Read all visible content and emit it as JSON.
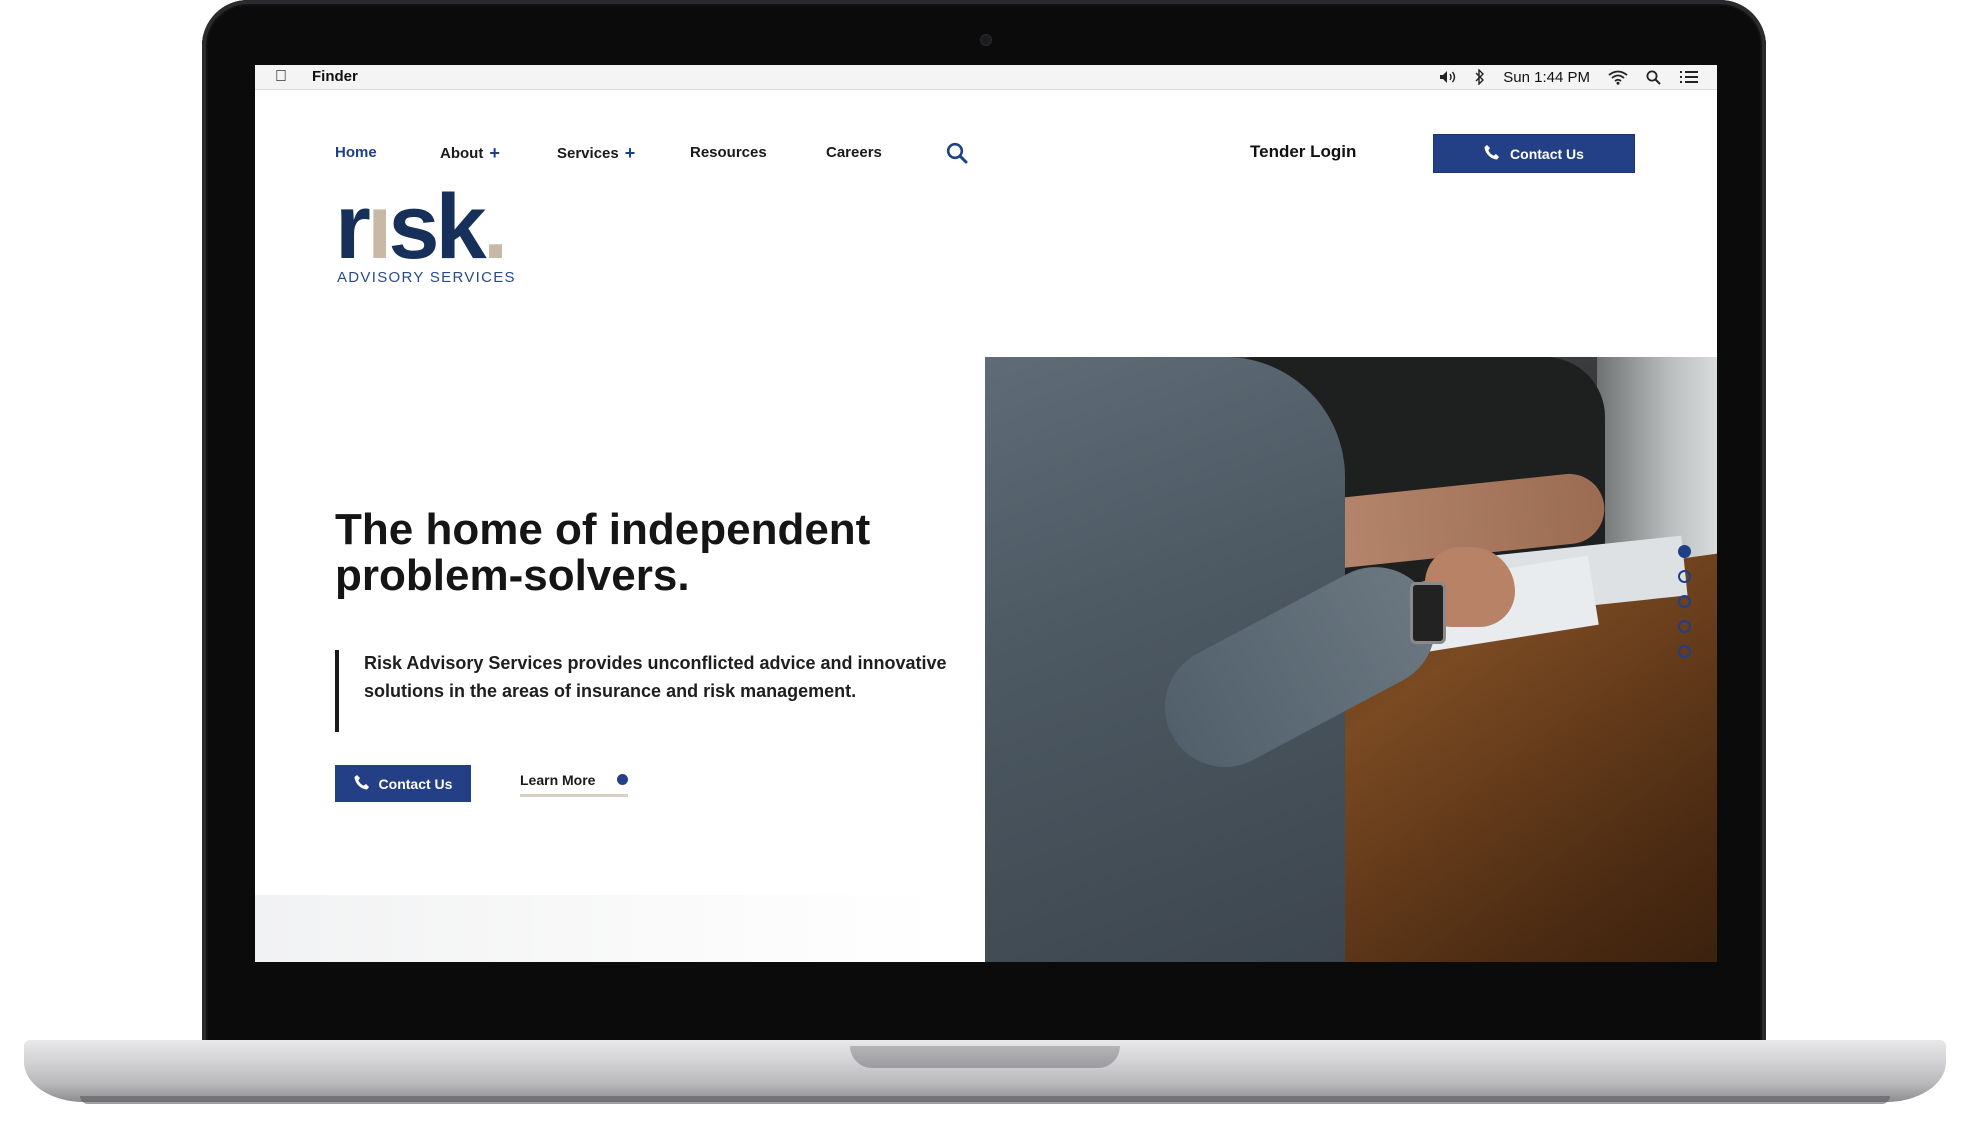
{
  "menubar": {
    "app_name": "Finder",
    "clock": "Sun 1:44 PM"
  },
  "nav": {
    "items": [
      {
        "label": "Home",
        "active": true
      },
      {
        "label": "About",
        "has_submenu": true
      },
      {
        "label": "Services",
        "has_submenu": true
      },
      {
        "label": "Resources"
      },
      {
        "label": "Careers"
      }
    ],
    "tender_login": "Tender Login",
    "contact_button": "Contact Us"
  },
  "logo": {
    "wordmark_start": "r",
    "wordmark_i": "ı",
    "wordmark_end": "sk",
    "wordmark_dot": ".",
    "tagline": "ADVISORY SERVICES"
  },
  "hero": {
    "title": "The home of independent problem-solvers.",
    "description": "Risk Advisory Services provides unconflicted advice and innovative solutions in the areas of insurance and risk management.",
    "contact_button": "Contact Us",
    "learn_more": "Learn More",
    "slides": 5,
    "active_slide": 1
  },
  "colors": {
    "brand_navy": "#233f86",
    "logo_navy": "#17305a",
    "logo_tan": "#c7b9a6"
  },
  "icons": [
    "apple-icon",
    "volume-icon",
    "bluetooth-icon",
    "wifi-icon",
    "spotlight-search-icon",
    "list-icon",
    "search-icon",
    "phone-icon"
  ]
}
